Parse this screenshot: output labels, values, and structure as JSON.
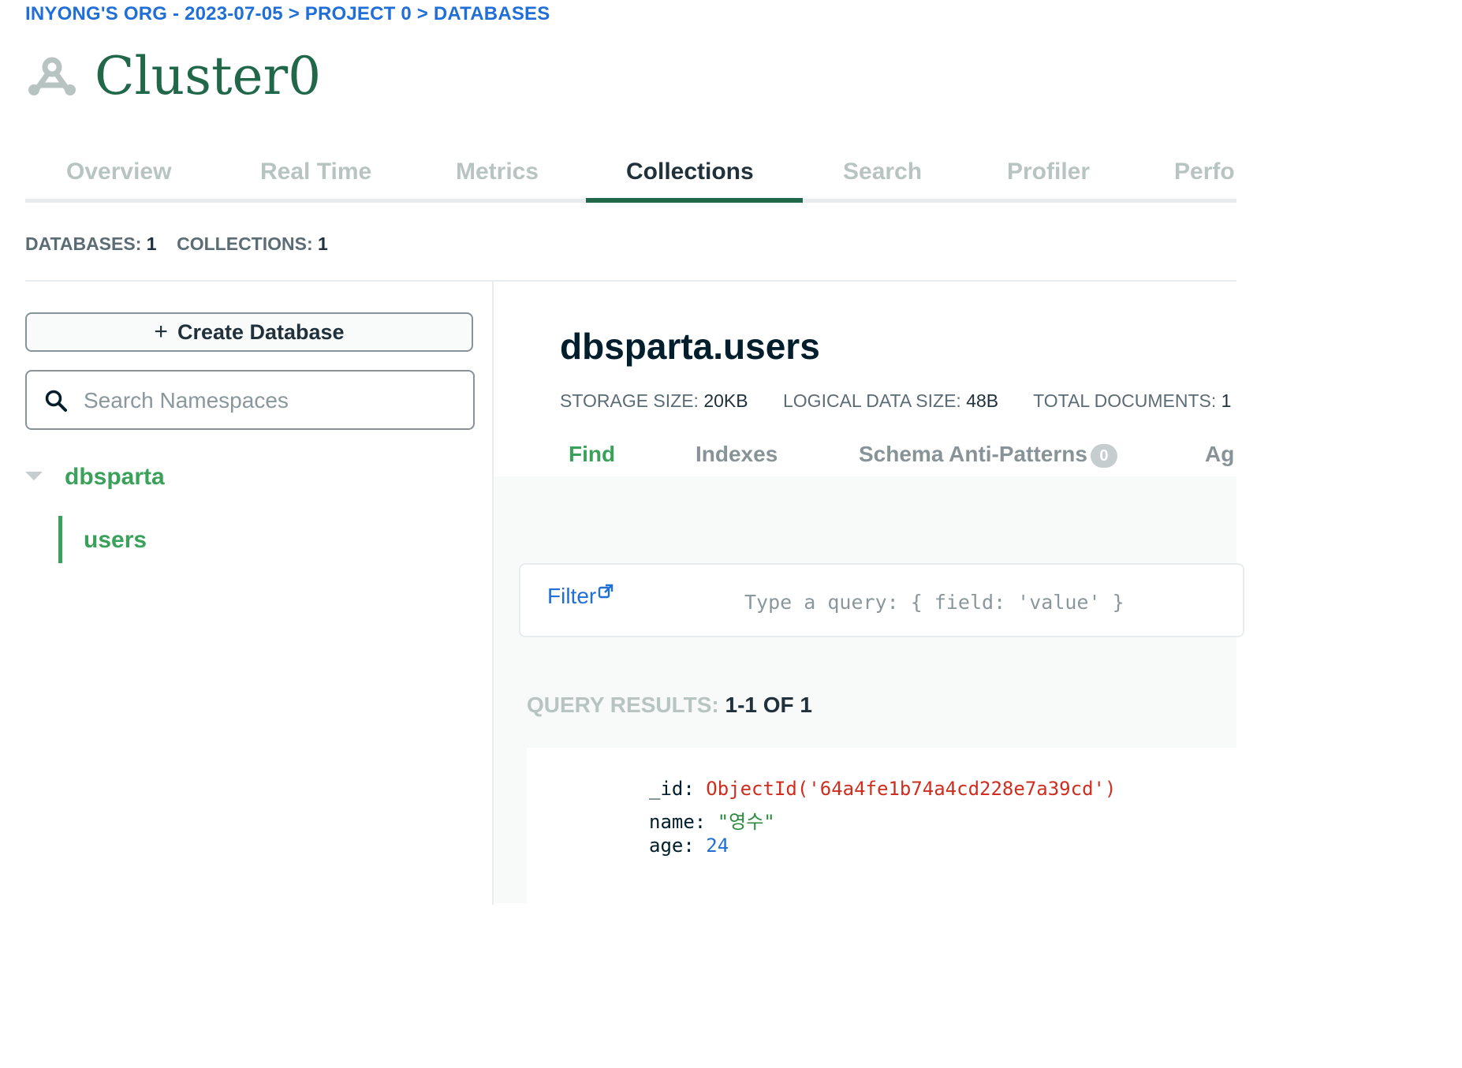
{
  "breadcrumb": {
    "text": "INYONG'S ORG - 2023-07-05 > PROJECT 0 > DATABASES"
  },
  "header": {
    "title": "Cluster0",
    "icon": "cluster-icon"
  },
  "tabs": [
    {
      "label": "Overview",
      "active": false
    },
    {
      "label": "Real Time",
      "active": false
    },
    {
      "label": "Metrics",
      "active": false
    },
    {
      "label": "Collections",
      "active": true
    },
    {
      "label": "Search",
      "active": false
    },
    {
      "label": "Profiler",
      "active": false
    },
    {
      "label": "Perfo",
      "active": false
    }
  ],
  "stats": {
    "databases_label": "DATABASES:",
    "databases_value": "1",
    "collections_label": "COLLECTIONS:",
    "collections_value": "1"
  },
  "sidebar": {
    "create_button": "Create Database",
    "search_placeholder": "Search Namespaces",
    "database": "dbsparta",
    "collection": "users"
  },
  "main": {
    "namespace": "dbsparta.users",
    "storage_label": "STORAGE SIZE:",
    "storage_value": "20KB",
    "logical_label": "LOGICAL DATA SIZE:",
    "logical_value": "48B",
    "docs_label": "TOTAL DOCUMENTS:",
    "docs_value": "1",
    "subtabs": [
      {
        "label": "Find",
        "active": true
      },
      {
        "label": "Indexes",
        "active": false
      },
      {
        "label": "Schema Anti-Patterns",
        "active": false,
        "badge": "0"
      },
      {
        "label": "Ag",
        "active": false
      }
    ],
    "filter_label": "Filter",
    "filter_placeholder": "Type a query: { field: 'value' }",
    "results_label": "QUERY RESULTS:",
    "results_value": "1-1 OF 1"
  },
  "document": {
    "id_key": "_id:",
    "id_value": "ObjectId('64a4fe1b74a4cd228e7a39cd')",
    "name_key": "name:",
    "name_value": "\"영수\"",
    "age_key": "age:",
    "age_value": "24"
  },
  "colors": {
    "brand_green": "#21674a",
    "accent_green": "#3aa15a",
    "link_blue": "#1f6fd6",
    "objectid_red": "#cf2d1e"
  }
}
